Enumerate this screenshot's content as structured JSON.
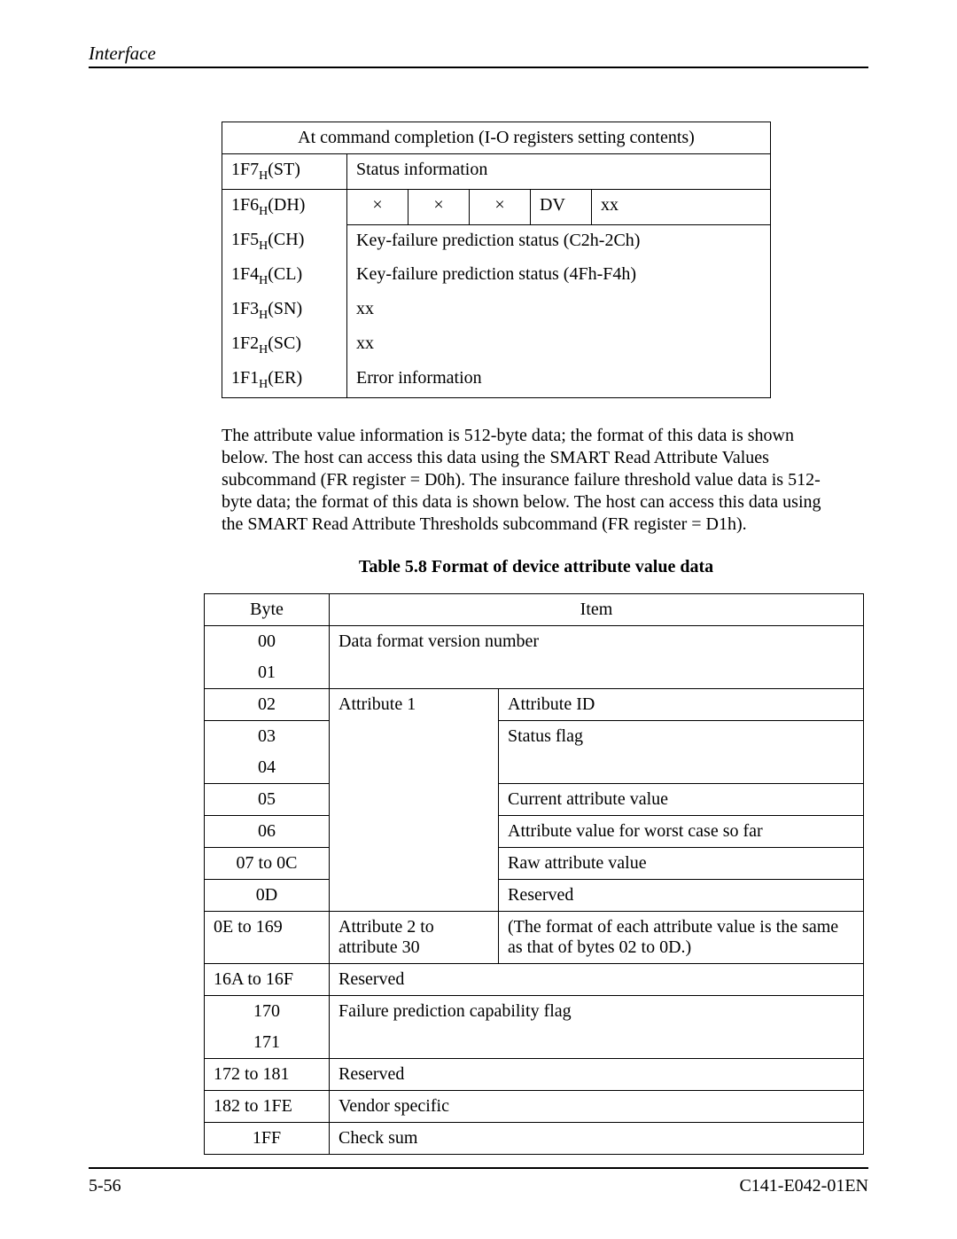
{
  "header": {
    "title": "Interface"
  },
  "footer": {
    "page_num": "5-56",
    "doc_id": "C141-E042-01EN"
  },
  "table1": {
    "title": "At command completion (I-O registers setting contents)",
    "rows": {
      "r1f7": {
        "reg": "1F7",
        "sub": "H",
        "mn": "(ST)",
        "desc": "Status information"
      },
      "r1f6": {
        "reg": "1F6",
        "sub": "H",
        "mn": "(DH)",
        "c1": "×",
        "c2": "×",
        "c3": "×",
        "c4": "DV",
        "c5": "xx"
      },
      "r1f5": {
        "reg": "1F5",
        "sub": "H",
        "mn": "(CH)",
        "desc": "Key-failure prediction status (C2h-2Ch)"
      },
      "r1f4": {
        "reg": "1F4",
        "sub": "H",
        "mn": "(CL)",
        "desc": "Key-failure prediction status (4Fh-F4h)"
      },
      "r1f3": {
        "reg": "1F3",
        "sub": "H",
        "mn": "(SN)",
        "desc": "xx"
      },
      "r1f2": {
        "reg": "1F2",
        "sub": "H",
        "mn": "(SC)",
        "desc": "xx"
      },
      "r1f1": {
        "reg": "1F1",
        "sub": "H",
        "mn": "(ER)",
        "desc": "Error information"
      }
    }
  },
  "paragraph": "The attribute value information is 512-byte data; the format of this data is shown below.  The host can access this data using the SMART Read Attribute Values subcommand (FR register = D0h).  The insurance failure threshold value data is 512-byte data; the format of this data is shown below.  The host can access this data using the SMART Read Attribute Thresholds subcommand (FR register = D1h).",
  "table2": {
    "caption": "Table 5.8   Format of device attribute value data",
    "headers": {
      "byte": "Byte",
      "item": "Item"
    },
    "rows": {
      "r00": {
        "byte": "00"
      },
      "r00_item": "Data format version number",
      "r01": {
        "byte": "01"
      },
      "r02": {
        "byte": "02",
        "attr": "Attribute 1",
        "item": "Attribute ID"
      },
      "r03": {
        "byte": "03",
        "item": "Status flag"
      },
      "r04": {
        "byte": "04"
      },
      "r05": {
        "byte": "05",
        "item": "Current attribute value"
      },
      "r06": {
        "byte": "06",
        "item": "Attribute value for worst case so far"
      },
      "r07": {
        "byte": "07 to 0C",
        "item": "Raw attribute value"
      },
      "r0d": {
        "byte": "0D",
        "item": "Reserved"
      },
      "r0e": {
        "byte": "0E to 169",
        "attr": "Attribute 2 to attribute 30",
        "item": "(The format of each attribute value is the same as that of bytes 02 to 0D.)"
      },
      "r16a": {
        "byte": "16A to 16F",
        "item": "Reserved"
      },
      "r170": {
        "byte": "170",
        "item": "Failure prediction capability flag"
      },
      "r171": {
        "byte": "171"
      },
      "r172": {
        "byte": "172 to 181",
        "item": "Reserved"
      },
      "r182": {
        "byte": "182 to 1FE",
        "item": "Vendor specific"
      },
      "r1ff": {
        "byte": "1FF",
        "item": "Check sum"
      }
    }
  }
}
